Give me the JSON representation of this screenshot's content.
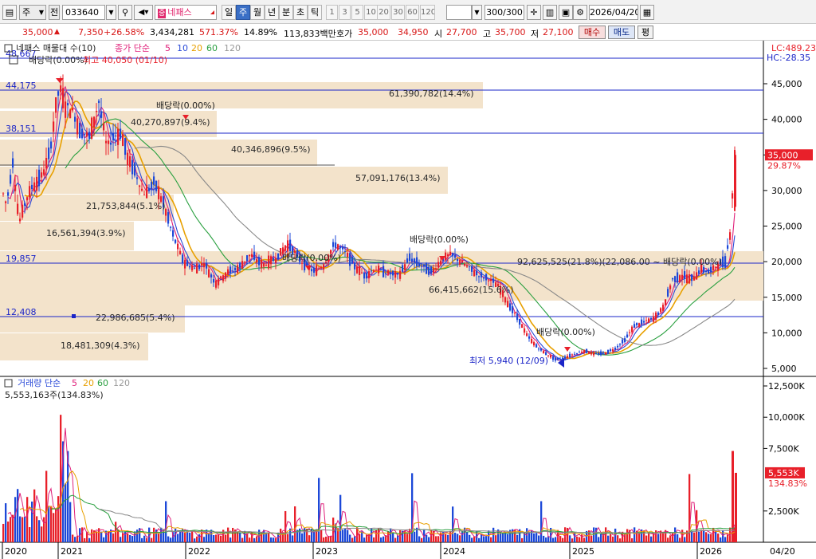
{
  "toolbar": {
    "type_select": "주",
    "prev_label": "전",
    "stock_code": "033640",
    "stock_name": "네패스",
    "periods": [
      {
        "label": "일",
        "active": false
      },
      {
        "label": "주",
        "active": true
      },
      {
        "label": "월",
        "active": false
      },
      {
        "label": "년",
        "active": false
      },
      {
        "label": "분",
        "active": false
      },
      {
        "label": "초",
        "active": false
      },
      {
        "label": "틱",
        "active": false
      }
    ],
    "intervals": [
      "1",
      "3",
      "5",
      "10",
      "20",
      "30",
      "60",
      "120"
    ],
    "count": "300",
    "count_total": "/300",
    "date": "2026/04/20"
  },
  "info": {
    "price": "35,000",
    "change": "7,350",
    "change_pct": "+26.58%",
    "volume": "3,434,281",
    "volume_ratio": "571.37%",
    "turnover": "14.89%",
    "amount": "113,833백만",
    "quote_label": "호가",
    "ask": "35,000",
    "bid": "34,950",
    "open_label": "시",
    "open": "27,700",
    "high_label": "고",
    "high": "35,700",
    "low_label": "저",
    "low": "27,100",
    "buy_label": "매수",
    "sell_label": "매도",
    "flat_label": "평"
  },
  "legend": {
    "series_name": "네패스 매물대 수(10)",
    "dividend_label": "배당락(0.00%)",
    "high_note": "최고 40,050 (01/10)",
    "ma_title": "종가 단순",
    "ma_periods": [
      "5",
      "10",
      "20",
      "60",
      "120"
    ],
    "ma_colors": [
      "#e0207a",
      "#2a4ad8",
      "#e8a000",
      "#2aa040",
      "#888888"
    ],
    "lc": "LC:489.23",
    "hc": "HC:-28.35"
  },
  "price_axis": {
    "ticks": [
      "45,000",
      "40,000",
      "35,000",
      "30,000",
      "25,000",
      "20,000",
      "15,000",
      "10,000",
      "5,000"
    ],
    "current_price": "35,000",
    "current_pct": "29.87%"
  },
  "hlines": [
    {
      "label": "48,667"
    },
    {
      "label": "44,175"
    },
    {
      "label": "38,151"
    },
    {
      "label": "19,857"
    },
    {
      "label": "12,408"
    }
  ],
  "volume_profile": [
    "61,390,782(14.4%)",
    "40,270,897(9.4%)",
    "40,346,896(9.5%)",
    "57,091,176(13.4%)",
    "21,753,844(5.1%)",
    "16,561,394(3.9%)",
    "92,625,525(21.8%)(22,086.00 ~ 배당락(0.00%)",
    "66,415,662(15.6%)",
    "22,986,685(5.4%)",
    "18,481,309(4.3%)"
  ],
  "annotations": {
    "dividend_1": "배당락(0.00%)",
    "dividend_2": "배당락(0.00%)",
    "dividend_3": "배당락(0.00%)",
    "dividend_4": "배당락(0.00%)",
    "low_note": "최저 5,940 (12/09)"
  },
  "volume_panel": {
    "title": "거래량 단순",
    "ma_periods": [
      "5",
      "20",
      "60",
      "120"
    ],
    "last_value": "5,553,163주(134.83%)",
    "ticks": [
      "12,500K",
      "10,000K",
      "7,500K",
      "2,500K"
    ],
    "current": "5,553K",
    "current_pct": "134.83%"
  },
  "x_axis": [
    "2020",
    "2021",
    "2022",
    "2023",
    "2024",
    "2025",
    "2026",
    "04/20"
  ],
  "chart_data": {
    "type": "candlestick",
    "xlabel": "",
    "ylabel": "",
    "ylim": [
      5000,
      48000
    ],
    "x": [
      "2020",
      "2021",
      "2022",
      "2023",
      "2024",
      "2025",
      "2026"
    ],
    "price_close_approx": [
      31000,
      42000,
      28000,
      18000,
      19000,
      6500,
      35000
    ],
    "volume_ylim": [
      0,
      12500
    ],
    "moving_average_periods": [
      5,
      10,
      20,
      60,
      120
    ]
  }
}
